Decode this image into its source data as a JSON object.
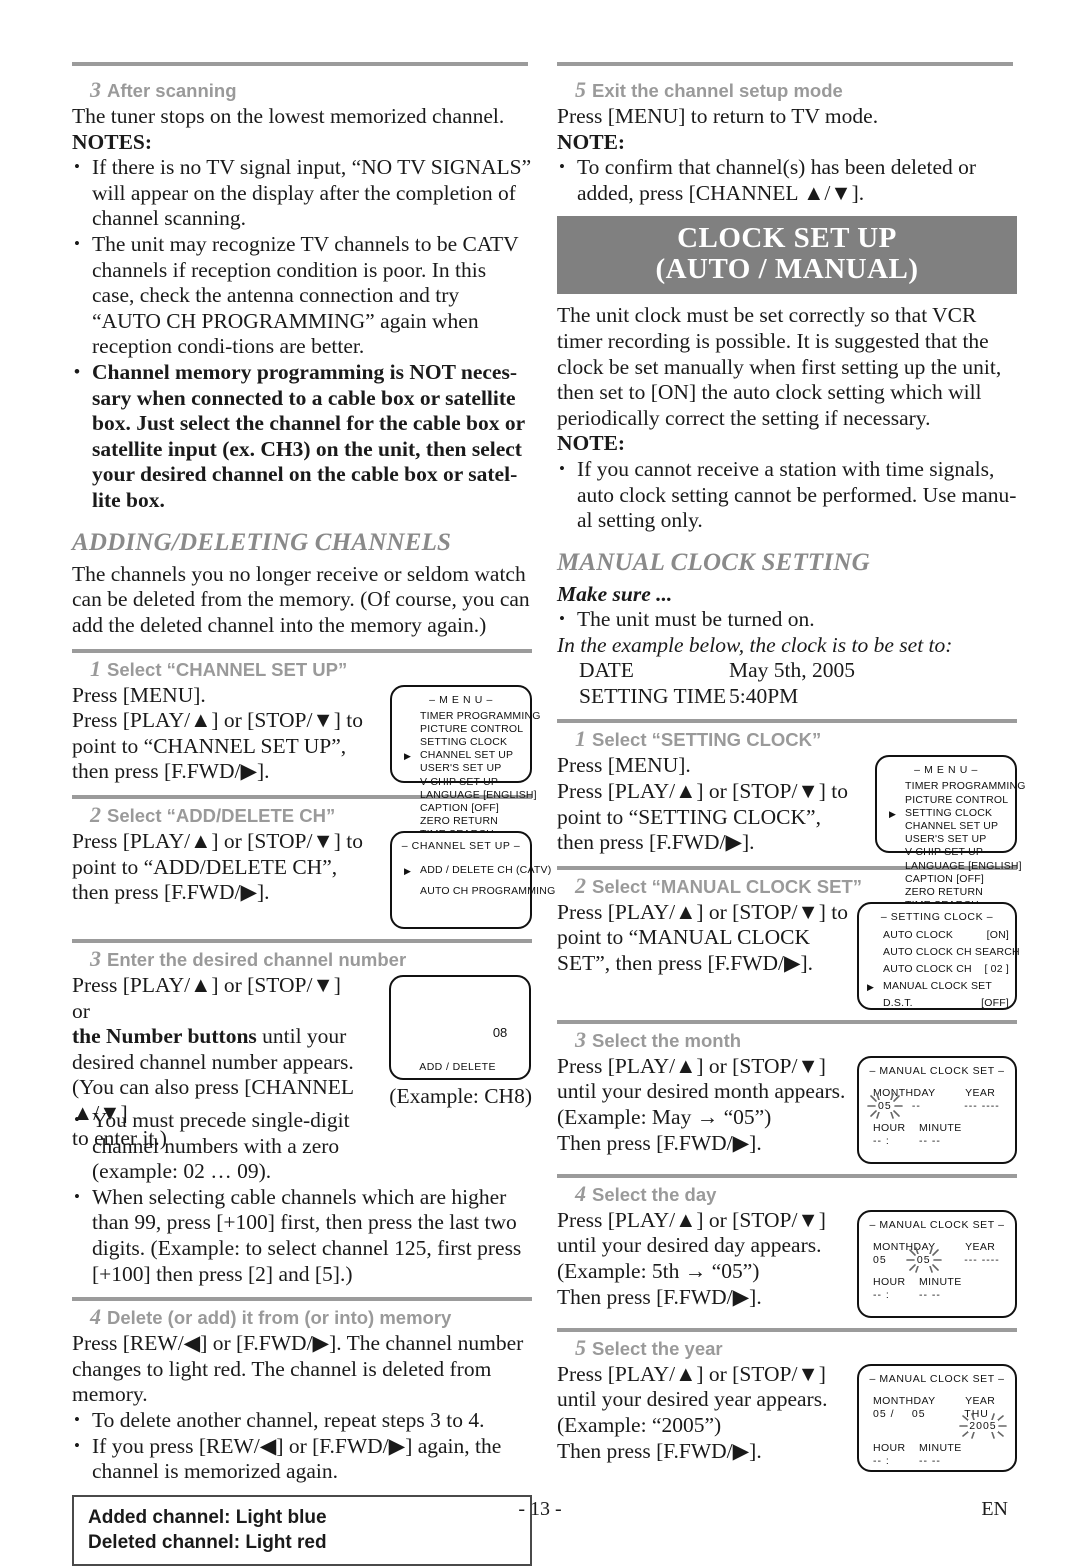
{
  "left_column": {
    "step3": {
      "num": "3",
      "title": "After scanning",
      "line1": "The tuner stops on the lowest memorized channel.",
      "notes_label": "NOTES:",
      "notes": [
        "If there is no TV signal input, “NO TV SIGNALS” will appear on the display after the completion of channel scanning.",
        "The unit may recognize TV channels to be CATV channels if reception condition is poor. In this case, check the antenna connection and try “AUTO CH PROGRAMMING” again when reception condi-tions are better.",
        "Channel memory programming is NOT neces-sary when connected to a cable box or satellite box. Just select the channel for the cable box or satellite input (ex. CH3) on the unit, then select your desired channel on the cable box or satel-lite box."
      ]
    },
    "adding_deleting": {
      "heading": "ADDING/DELETING CHANNELS",
      "intro": "The channels you no longer receive or seldom watch can be deleted from the memory. (Of course, you can add the deleted channel into the memory again.)"
    },
    "step1": {
      "num": "1",
      "title": "Select “CHANNEL SET UP”",
      "line1": "Press [MENU].",
      "line2": "Press [PLAY/▲] or [STOP/▼] to",
      "line3": "point to “CHANNEL SET UP”,",
      "line4": "then press [F.FWD/▶]."
    },
    "step2": {
      "num": "2",
      "title": "Select “ADD/DELETE CH”",
      "line1": "Press [PLAY/▲] or [STOP/▼] to",
      "line2": "point to “ADD/DELETE CH”,",
      "line3": "then press [F.FWD/▶]."
    },
    "step3b": {
      "num": "3",
      "title": "Enter the desired channel number",
      "line1": "Press [PLAY/▲] or [STOP/▼] or",
      "line2_bold": "the Number buttons",
      "line2_rest": " until your",
      "line3": "desired channel number appears.",
      "line4": "(You can also press [CHANNEL ▲/▼]",
      "line5": "to enter it.)",
      "example_caption": "(Example: CH8)",
      "bullets": [
        "You must precede single-digit channel numbers with a zero (example: 02 … 09).",
        "When selecting cable channels which are higher than 99, press [+100] first, then press the last two digits. (Example: to select channel 125, first press [+100] then press [2] and [5].)"
      ]
    },
    "step4": {
      "num": "4",
      "title": "Delete (or add) it from (or into) memory",
      "line1": "Press [REW/◀] or [F.FWD/▶]. The channel number",
      "line2": "changes to light red. The channel is deleted from memory.",
      "bullets": [
        "To delete another channel, repeat steps 3 to 4.",
        "If you press [REW/◀] or [F.FWD/▶] again, the channel is memorized again."
      ]
    },
    "boxnote": {
      "line1": "Added channel: Light blue",
      "line2": "Deleted channel: Light red"
    }
  },
  "right_column": {
    "step5": {
      "num": "5",
      "title": "Exit the channel setup mode",
      "line1": "Press [MENU] to return to TV mode.",
      "note_label": "NOTE:",
      "notes": [
        "To confirm that channel(s) has been deleted or added, press [CHANNEL ▲/▼]."
      ]
    },
    "banner": {
      "line1": "CLOCK SET UP",
      "line2": "(AUTO / MANUAL)"
    },
    "clock_intro": "The unit clock must be set correctly so that VCR timer recording is possible. It is suggested that the clock be set manually when first setting up the unit, then set to [ON] the auto clock setting which will periodically correct the setting if necessary.",
    "clock_note_label": "NOTE:",
    "clock_notes": [
      "If you cannot receive a station with time signals, auto clock setting cannot be performed. Use manu-al setting only."
    ],
    "manual_heading": "MANUAL CLOCK SETTING",
    "make_sure": "Make sure ...",
    "make_sure_bullets": [
      "The unit must be turned on."
    ],
    "example_line": "In the example below, the clock is to be set to:",
    "date_rows": [
      {
        "key": "DATE",
        "value": "May 5th, 2005"
      },
      {
        "key": "SETTING TIME",
        "value": "5:40PM"
      }
    ],
    "step1": {
      "num": "1",
      "title": "Select “SETTING CLOCK”",
      "line1": "Press [MENU].",
      "line2": "Press [PLAY/▲] or [STOP/▼] to",
      "line3": "point to “SETTING CLOCK”,",
      "line4": "then press [F.FWD/▶]."
    },
    "step2": {
      "num": "2",
      "title": "Select “MANUAL CLOCK SET”",
      "line1": "Press [PLAY/▲] or [STOP/▼] to",
      "line2": "point to “MANUAL CLOCK",
      "line3": "SET”, then press [F.FWD/▶]."
    },
    "step3": {
      "num": "3",
      "title": "Select the month",
      "line1": "Press [PLAY/▲] or [STOP/▼]",
      "line2": "until your desired month appears.",
      "line3": "(Example: May → “05”)",
      "line4": "Then press [F.FWD/▶]."
    },
    "step4": {
      "num": "4",
      "title": "Select the day",
      "line1": "Press [PLAY/▲] or [STOP/▼]",
      "line2": "until your desired day appears.",
      "line3": "(Example: 5th → “05”)",
      "line4": "Then press [F.FWD/▶]."
    },
    "step5b": {
      "num": "5",
      "title": "Select the year",
      "line1": "Press [PLAY/▲] or [STOP/▼]",
      "line2": "until your desired year appears.",
      "line3": "(Example: “2005”)",
      "line4": "Then press [F.FWD/▶]."
    }
  },
  "osd": {
    "menu_channel": {
      "title": "– M E N U –",
      "items": [
        {
          "label": "TIMER PROGRAMMING",
          "selected": false
        },
        {
          "label": "PICTURE CONTROL",
          "selected": false
        },
        {
          "label": "SETTING CLOCK",
          "selected": false
        },
        {
          "label": "CHANNEL SET UP",
          "selected": true
        },
        {
          "label": "USER'S SET UP",
          "selected": false
        },
        {
          "label": "V-CHIP SET UP",
          "selected": false
        },
        {
          "label": "LANGUAGE  [ENGLISH]",
          "selected": false
        },
        {
          "label": "CAPTION  [OFF]",
          "selected": false
        },
        {
          "label": "ZERO RETURN",
          "selected": false
        },
        {
          "label": "TIME SEARCH",
          "selected": false
        }
      ]
    },
    "menu_clock": {
      "title": "– M E N U –",
      "items": [
        {
          "label": "TIMER PROGRAMMING",
          "selected": false
        },
        {
          "label": "PICTURE CONTROL",
          "selected": false
        },
        {
          "label": "SETTING CLOCK",
          "selected": true
        },
        {
          "label": "CHANNEL SET UP",
          "selected": false
        },
        {
          "label": "USER'S SET UP",
          "selected": false
        },
        {
          "label": "V-CHIP SET UP",
          "selected": false
        },
        {
          "label": "LANGUAGE  [ENGLISH]",
          "selected": false
        },
        {
          "label": "CAPTION  [OFF]",
          "selected": false
        },
        {
          "label": "ZERO RETURN",
          "selected": false
        },
        {
          "label": "TIME SEARCH",
          "selected": false
        }
      ]
    },
    "channel_setup": {
      "title": "– CHANNEL SET UP –",
      "items": [
        {
          "label": "ADD / DELETE CH (CATV)",
          "selected": true
        },
        {
          "label": "AUTO CH PROGRAMMING",
          "selected": false
        }
      ]
    },
    "add_delete": {
      "number": "08",
      "label": "ADD / DELETE"
    },
    "setting_clock": {
      "title": "– SETTING CLOCK –",
      "items": [
        {
          "label": "AUTO CLOCK",
          "value": "[ON]",
          "selected": false
        },
        {
          "label": "AUTO CLOCK CH SEARCH",
          "value": "",
          "selected": false
        },
        {
          "label": "AUTO CLOCK CH",
          "value": "[ 02 ]",
          "selected": false
        },
        {
          "label": "MANUAL CLOCK SET",
          "value": "",
          "selected": true
        },
        {
          "label": "D.S.T.",
          "value": "[OFF]",
          "selected": false
        }
      ]
    },
    "manual_clock_month": {
      "title": "– MANUAL CLOCK SET –",
      "h_month": "MONTH",
      "h_day": "DAY",
      "h_year": "YEAR",
      "v_month": "05",
      "v_sep": "",
      "v_day": "--",
      "v_dow": "---",
      "v_year": "----",
      "h_hour": "HOUR",
      "h_minute": "MINUTE",
      "v_hour": "--",
      "v_colon": ":",
      "v_min": "--",
      "v_ampm": "--",
      "blink": "month"
    },
    "manual_clock_day": {
      "title": "– MANUAL CLOCK SET –",
      "h_month": "MONTH",
      "h_day": "DAY",
      "h_year": "YEAR",
      "v_month": "05",
      "v_sep": "",
      "v_day": "05",
      "v_dow": "---",
      "v_year": "----",
      "h_hour": "HOUR",
      "h_minute": "MINUTE",
      "v_hour": "--",
      "v_colon": ":",
      "v_min": "--",
      "v_ampm": "--",
      "blink": "day"
    },
    "manual_clock_year": {
      "title": "– MANUAL CLOCK SET –",
      "h_month": "MONTH",
      "h_day": "DAY",
      "h_year": "YEAR",
      "v_month": "05",
      "v_sep": "/",
      "v_day": "05",
      "v_dow": "THU",
      "v_year": "2005",
      "h_hour": "HOUR",
      "h_minute": "MINUTE",
      "v_hour": "--",
      "v_colon": ":",
      "v_min": "--",
      "v_ampm": "--",
      "blink": "year"
    }
  },
  "footer": {
    "page": "- 13 -",
    "lang": "EN"
  },
  "colors": {
    "banner_bg": "#808080",
    "rule": "#9b9b9b",
    "step_head": "#9a9a9a",
    "heading": "#8a8a8a"
  }
}
